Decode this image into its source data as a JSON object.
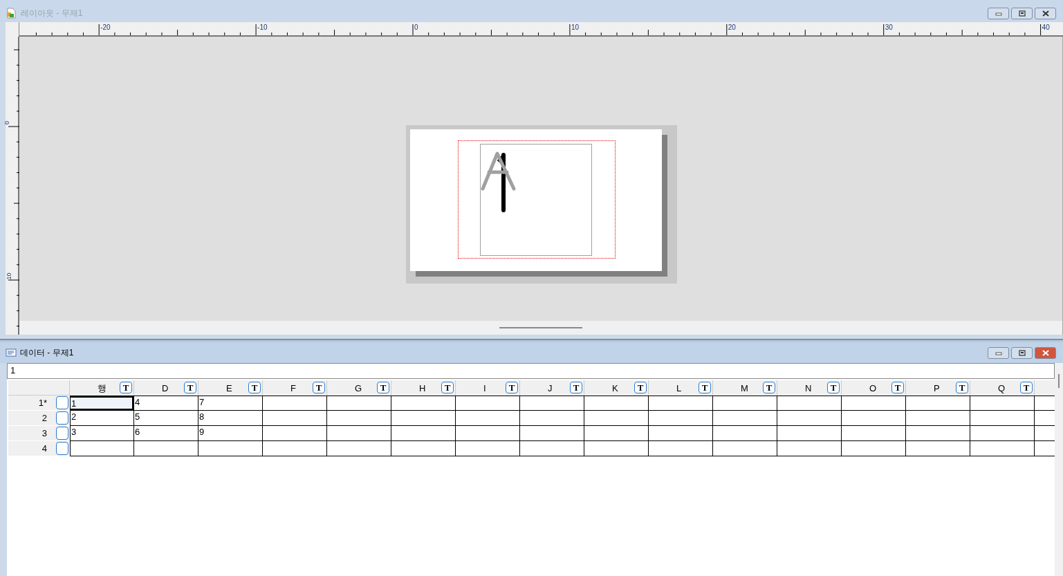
{
  "layout_window": {
    "title": "레이아웃  - 무제1",
    "active": false,
    "ruler_x_labels": [
      "-20",
      "-10",
      "0",
      "10",
      "20",
      "30",
      "40"
    ],
    "ruler_y_labels": [
      "0",
      "10"
    ]
  },
  "data_window": {
    "title": "데이터  - 무제1",
    "active": true,
    "entry_value": "1",
    "columns": [
      {
        "label": "행",
        "type_button": "T"
      },
      {
        "label": "D",
        "type_button": "T"
      },
      {
        "label": "E",
        "type_button": "T"
      },
      {
        "label": "F",
        "type_button": "T"
      },
      {
        "label": "G",
        "type_button": "T"
      },
      {
        "label": "H",
        "type_button": "T"
      },
      {
        "label": "I",
        "type_button": "T"
      },
      {
        "label": "J",
        "type_button": "T"
      },
      {
        "label": "K",
        "type_button": "T"
      },
      {
        "label": "L",
        "type_button": "T"
      },
      {
        "label": "M",
        "type_button": "T"
      },
      {
        "label": "N",
        "type_button": "T"
      },
      {
        "label": "O",
        "type_button": "T"
      },
      {
        "label": "P",
        "type_button": "T"
      },
      {
        "label": "Q",
        "type_button": "T"
      }
    ],
    "rows": [
      {
        "label": "1*",
        "checked": false,
        "cells": [
          {
            "text": "1",
            "selected": true
          },
          {
            "text": "4",
            "selected": false
          },
          {
            "text": "7",
            "selected": false
          }
        ]
      },
      {
        "label": "2",
        "checked": false,
        "cells": [
          {
            "text": "2",
            "selected": false
          },
          {
            "text": "5",
            "selected": false
          },
          {
            "text": "8",
            "selected": false
          }
        ]
      },
      {
        "label": "3",
        "checked": false,
        "cells": [
          {
            "text": "3",
            "selected": false
          },
          {
            "text": "6",
            "selected": false
          },
          {
            "text": "9",
            "selected": false
          }
        ]
      },
      {
        "label": "4",
        "checked": false
      }
    ]
  }
}
